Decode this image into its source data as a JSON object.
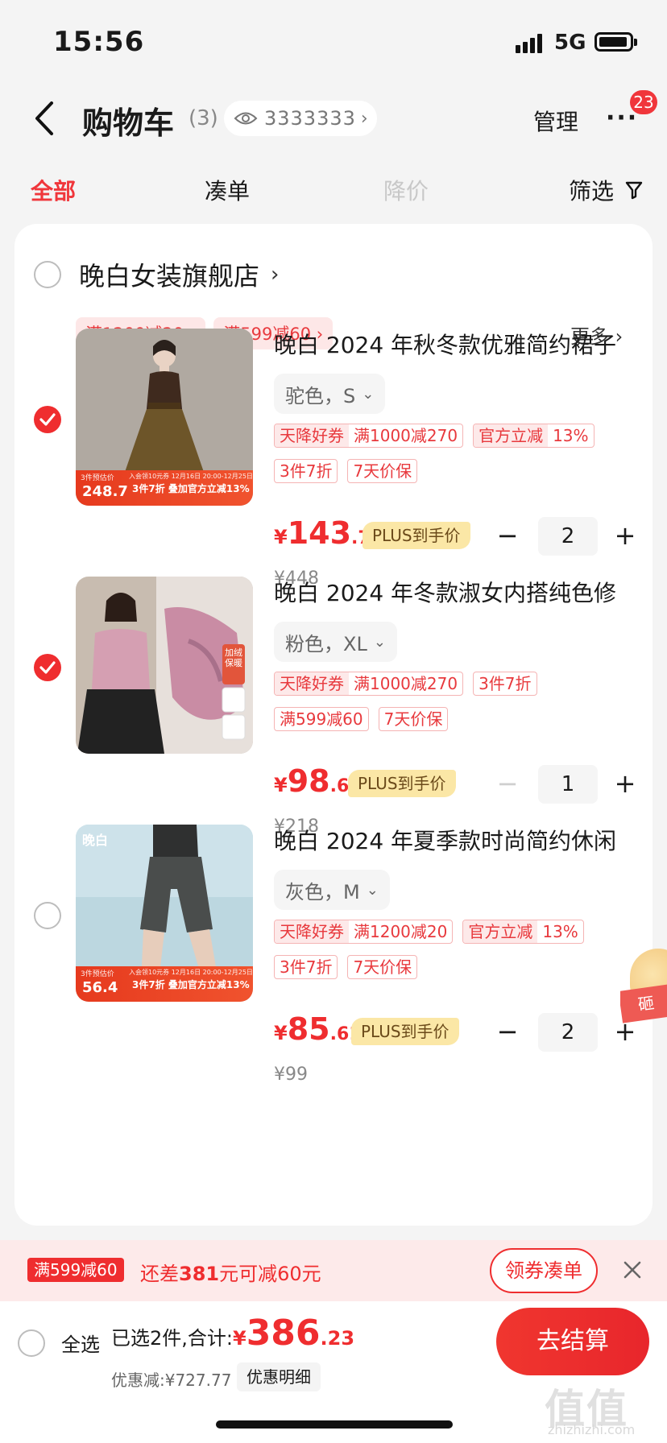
{
  "status_bar": {
    "time": "15:56",
    "network": "5G"
  },
  "nav": {
    "title": "购物车",
    "count": "(3)",
    "watch_number": "3333333",
    "manage": "管理",
    "more_badge": "23"
  },
  "tabs": [
    {
      "label": "全部",
      "state": "active"
    },
    {
      "label": "凑单",
      "state": "normal"
    },
    {
      "label": "降价",
      "state": "disabled"
    }
  ],
  "filter_label": "筛选",
  "store": {
    "name": "晚白女装旗舰店",
    "promos": [
      "满1200减20 ›",
      "满599减60 ›"
    ],
    "more": "更多 ›"
  },
  "items": [
    {
      "checked": true,
      "title": "晚白 2024 年秋冬款优雅简约裙子",
      "sku": "驼色，S",
      "tags": [
        {
          "k": "天降好券",
          "v": "满1000减270"
        },
        {
          "k": "官方立减",
          "v": "13%"
        },
        {
          "k": "",
          "v": "3件7折"
        },
        {
          "k": "",
          "v": "7天价保"
        }
      ],
      "price_int": "143",
      "price_dec": ".78",
      "plus_label": "PLUS到手价",
      "quantity": "2",
      "minus_disabled": false,
      "original_price": "¥448",
      "thumb_banner": {
        "label": "3件预估价",
        "price": "248.7",
        "promo": "3件7折 叠加官方立减13%",
        "time": "入会领10元券  12月16日 20:00-12月25日"
      }
    },
    {
      "checked": true,
      "title": "晚白 2024 年冬款淑女内搭纯色修",
      "sku": "粉色，XL",
      "tags": [
        {
          "k": "天降好券",
          "v": "满1000减270"
        },
        {
          "k": "",
          "v": "3件7折"
        },
        {
          "k": "",
          "v": "满599减60"
        },
        {
          "k": "",
          "v": "7天价保"
        }
      ],
      "price_int": "98",
      "price_dec": ".67",
      "plus_label": "PLUS到手价",
      "quantity": "1",
      "minus_disabled": true,
      "original_price": "¥218",
      "thumb_badge": "加绒保暖"
    },
    {
      "checked": false,
      "title": "晚白 2024 年夏季款时尚简约休闲",
      "sku": "灰色，M",
      "tags": [
        {
          "k": "天降好券",
          "v": "满1200减20"
        },
        {
          "k": "官方立减",
          "v": "13%"
        },
        {
          "k": "",
          "v": "3件7折"
        },
        {
          "k": "",
          "v": "7天价保"
        }
      ],
      "price_int": "85",
      "price_dec": ".61",
      "plus_label": "PLUS到手价",
      "quantity": "2",
      "minus_disabled": false,
      "original_price": "¥99",
      "thumb_brand": "晚白",
      "thumb_banner": {
        "label": "3件预估价",
        "price": "56.4",
        "promo": "3件7折 叠加官方立减13%",
        "time": "入会领10元券  12月16日 20:00-12月25日"
      }
    }
  ],
  "side_bubble": "砸",
  "promo_bar": {
    "tag": "满599减60",
    "text_prefix": "还差",
    "text_amount": "381",
    "text_suffix": "元可减60元",
    "button": "领券凑单"
  },
  "bottom": {
    "select_all": "全选",
    "selected_text": "已选2件,合计:",
    "currency": "¥",
    "total_int": "386",
    "total_dec": ".23",
    "discount": "优惠减:¥727.77",
    "detail": "优惠明细",
    "checkout": "去结算"
  },
  "watermark": {
    "logo": "值值值",
    "site": "zhizhizhi.com"
  },
  "colors": {
    "accent": "#ef2d2f",
    "plus": "#fbe7a6"
  }
}
